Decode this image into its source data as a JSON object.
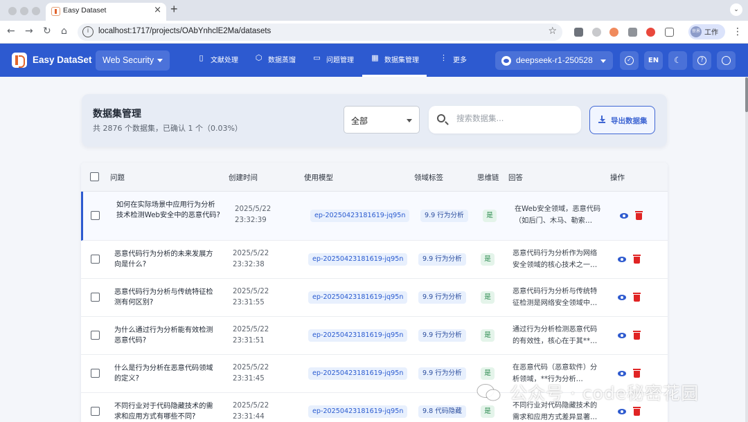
{
  "browser": {
    "tab_title": "Easy Dataset",
    "tab_close": "×",
    "new_tab": "+",
    "menu_icon": "⌄",
    "url": "localhost:1717/projects/OAbYnhclE2Ma/datasets",
    "profile_label": "工作",
    "profile_avatar": "世界",
    "nav_back": "←",
    "nav_forward": "→",
    "nav_reload": "↻",
    "nav_home": "⌂",
    "bookmark": "☆",
    "more": "⋮"
  },
  "app": {
    "brand": "Easy DataSet",
    "project": "Web Security",
    "nav": [
      {
        "label": "文献处理",
        "icon": "document-icon",
        "glyph": "▯"
      },
      {
        "label": "数据蒸馏",
        "icon": "cube-icon",
        "glyph": "⬡"
      },
      {
        "label": "问题管理",
        "icon": "chat-icon",
        "glyph": "▭"
      },
      {
        "label": "数据集管理",
        "icon": "dataset-icon",
        "glyph": "▦"
      },
      {
        "label": "更多",
        "icon": "more-icon",
        "glyph": "⋮"
      }
    ],
    "model": "deepseek-r1-250528",
    "lang": "EN",
    "check_glyph": "✓",
    "moon_glyph": "☾",
    "help_glyph": "?",
    "github_glyph": "⬤"
  },
  "page": {
    "title": "数据集管理",
    "summary": "共 2876 个数据集，已确认 1 个（0.03%）",
    "filter_value": "全部",
    "search_placeholder": "搜索数据集...",
    "export_label": "导出数据集"
  },
  "table": {
    "headers": {
      "question": "问题",
      "created": "创建时间",
      "model": "使用模型",
      "tag": "领域标签",
      "cot": "思维链",
      "answer": "回答",
      "actions": "操作"
    },
    "rows": [
      {
        "question": "如何在实际场景中应用行为分析技术检测Web安全中的恶意代码?",
        "date": "2025/5/22",
        "time": "23:32:39",
        "model": "ep-20250423181619-jq95n",
        "tag": "9.9 行为分析",
        "cot": "是",
        "answer": "在Web安全领域，恶意代码（如后门、木马、勒索…"
      },
      {
        "question": "恶意代码行为分析的未来发展方向是什么?",
        "date": "2025/5/22",
        "time": "23:32:38",
        "model": "ep-20250423181619-jq95n",
        "tag": "9.9 行为分析",
        "cot": "是",
        "answer": "恶意代码行为分析作为网络安全领域的核心技术之一…"
      },
      {
        "question": "恶意代码行为分析与传统特征检测有何区别?",
        "date": "2025/5/22",
        "time": "23:31:55",
        "model": "ep-20250423181619-jq95n",
        "tag": "9.9 行为分析",
        "cot": "是",
        "answer": "恶意代码行为分析与传统特征检测是网络安全领域中…"
      },
      {
        "question": "为什么通过行为分析能有效检测恶意代码?",
        "date": "2025/5/22",
        "time": "23:31:51",
        "model": "ep-20250423181619-jq95n",
        "tag": "9.9 行为分析",
        "cot": "是",
        "answer": "通过行为分析检测恶意代码的有效性，核心在于其**…"
      },
      {
        "question": "什么是行为分析在恶意代码领域的定义?",
        "date": "2025/5/22",
        "time": "23:31:45",
        "model": "ep-20250423181619-jq95n",
        "tag": "9.9 行为分析",
        "cot": "是",
        "answer": "在恶意代码（恶意软件）分析领域，**行为分析…"
      },
      {
        "question": "不同行业对于代码隐藏技术的需求和应用方式有哪些不同?",
        "date": "2025/5/22",
        "time": "23:31:44",
        "model": "ep-20250423181619-jq95n",
        "tag": "9.8 代码隐藏",
        "cot": "是",
        "answer": "不同行业对代码隐藏技术的需求和应用方式差异显著…"
      }
    ]
  },
  "watermark": "公众号 · code秘密花园",
  "colors": {
    "brand_blue": "#2d5ad0",
    "delete_red": "#e02424",
    "cot_green": "#2b8a4f"
  }
}
